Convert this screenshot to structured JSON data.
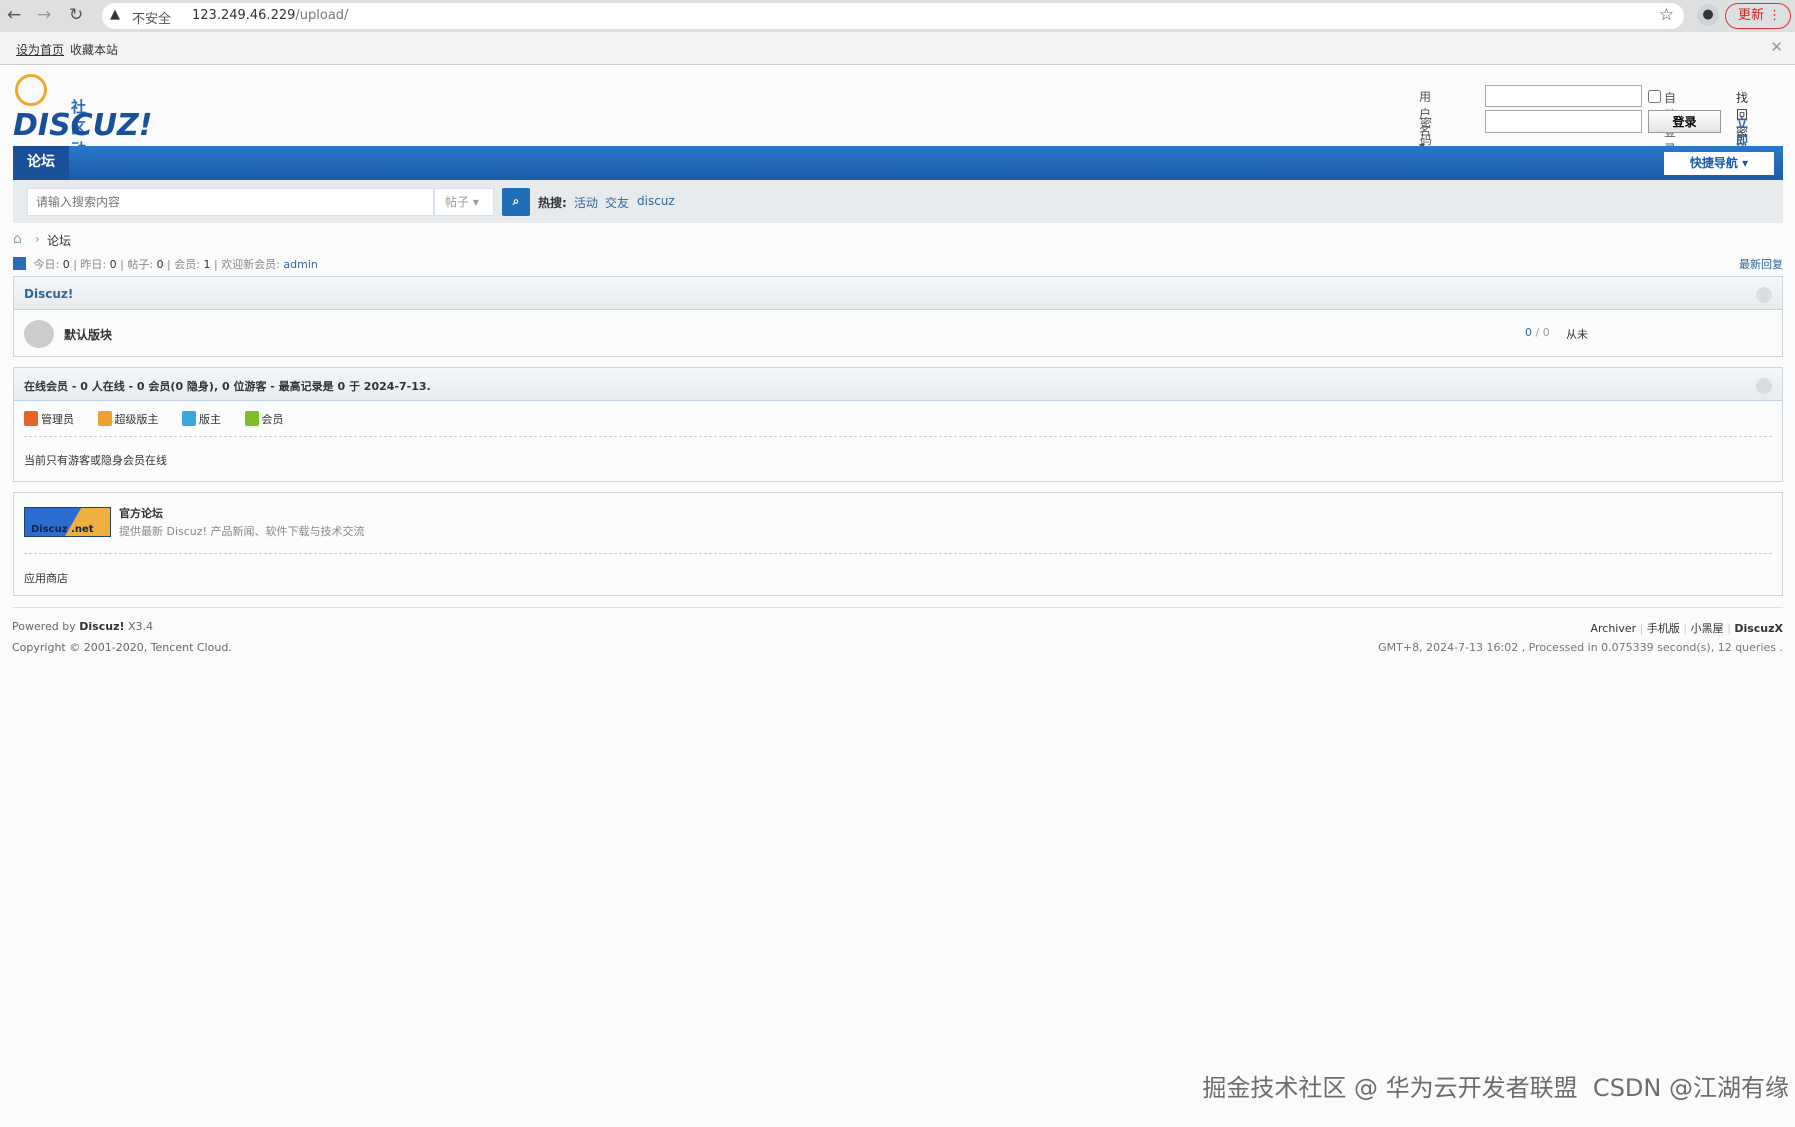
{
  "browser": {
    "security": "不安全",
    "url_host": "123.249.46.229",
    "url_path": "/upload/",
    "update_label": "更新"
  },
  "topbar": {
    "set_home": "设为首页",
    "bookmark": "收藏本站"
  },
  "logo": {
    "tagline": "社区动力",
    "brand": "DISCUZ!"
  },
  "login": {
    "username_label": "用户名",
    "password_label": "密码",
    "auto_login": "自动登录",
    "login_button": "登录",
    "find_password": "找回密码",
    "register": "立即注册"
  },
  "nav": {
    "tab": "论坛",
    "quick_nav": "快捷导航"
  },
  "search": {
    "placeholder": "请输入搜索内容",
    "type": "帖子",
    "hot_label": "热搜:",
    "hot": [
      "活动",
      "交友",
      "discuz"
    ]
  },
  "breadcrumb": {
    "current": "论坛"
  },
  "stats": {
    "today_label": "今日:",
    "today": "0",
    "yesterday_label": "昨日:",
    "yesterday": "0",
    "posts_label": "帖子:",
    "posts": "0",
    "members_label": "会员:",
    "members": "1",
    "newest_label": "欢迎新会员:",
    "newest": "admin",
    "latest_replies": "最新回复"
  },
  "category": {
    "title": "Discuz!",
    "forum": {
      "name": "默认版块",
      "threads": "0",
      "posts": "0",
      "last_post": "从未"
    }
  },
  "online": {
    "title": "在线会员 - 0 人在线 - 0 会员(0 隐身), 0 位游客 - 最高记录是 0 于 2024-7-13.",
    "legend": [
      {
        "label": "管理员",
        "color": "#e8622a"
      },
      {
        "label": "超级版主",
        "color": "#f0a030"
      },
      {
        "label": "版主",
        "color": "#3aa8e0"
      },
      {
        "label": "会员",
        "color": "#7cc028"
      }
    ],
    "message": "当前只有游客或隐身会员在线"
  },
  "links": {
    "logo_text": "Discuz .net",
    "name": "官方论坛",
    "desc": "提供最新 Discuz! 产品新闻、软件下载与技术交流",
    "app_store": "应用商店"
  },
  "footer": {
    "powered_prefix": "Powered by",
    "powered_brand": "Discuz!",
    "version": "X3.4",
    "copyright": "Copyright © 2001-2020, Tencent Cloud.",
    "links": [
      "Archiver",
      "手机版",
      "小黑屋",
      "DiscuzX"
    ],
    "process": "GMT+8, 2024-7-13 16:02 , Processed in 0.075339 second(s), 12 queries ."
  },
  "watermark": "掘金技术社区 @ 华为云开发者联盟  CSDN @江湖有缘"
}
